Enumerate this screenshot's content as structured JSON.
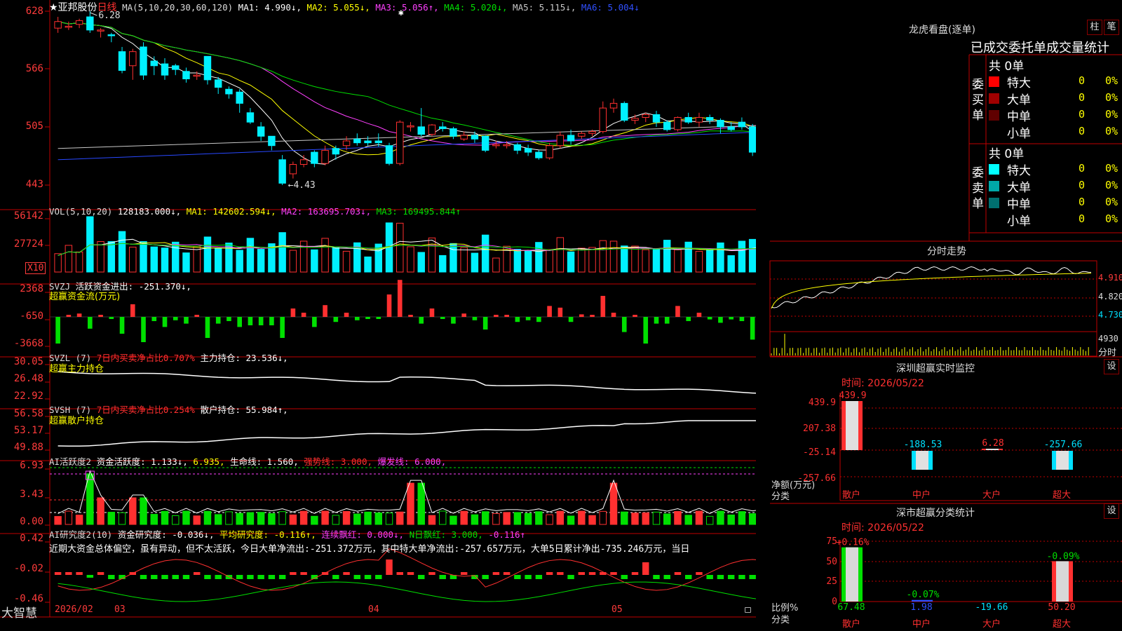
{
  "colors": {
    "up": "#ff3030",
    "down": "#00f0ff",
    "grid": "#c00000",
    "axis": "#ff3b3b",
    "white": "#ffffff",
    "yellow": "#ffff00",
    "magenta": "#ff40ff",
    "green": "#00e000",
    "blue": "#2848ff",
    "gray": "#a0a0a0"
  },
  "main": {
    "title_stock": "★亚邦股份",
    "title_period": "日线",
    "ma_header": [
      {
        "t": "MA(5,10,20,30,60,120)",
        "c": "#dddddd"
      },
      {
        "t": "MA1: 4.990↓,",
        "c": "#ffffff"
      },
      {
        "t": "MA2: 5.055↓,",
        "c": "#ffff00"
      },
      {
        "t": "MA3: 5.056↑,",
        "c": "#ff40ff"
      },
      {
        "t": "MA4: 5.020↓,",
        "c": "#00e000"
      },
      {
        "t": "MA5: 5.115↓,",
        "c": "#c8c8c8"
      },
      {
        "t": "MA6: 5.004↓",
        "c": "#3050ff"
      }
    ],
    "y_ticks": [
      "628",
      "566",
      "505",
      "443"
    ],
    "y_values": [
      6.28,
      5.66,
      5.05,
      4.43
    ],
    "high_label": "6.28",
    "low_label": "←4.43"
  },
  "vol": {
    "header": [
      {
        "t": "VOL(5,10,20)",
        "c": "#dddddd"
      },
      {
        "t": "128183.000↓,",
        "c": "#ffffff"
      },
      {
        "t": "MA1: 142602.594↓,",
        "c": "#ffff00"
      },
      {
        "t": "MA2: 163695.703↓,",
        "c": "#ff40ff"
      },
      {
        "t": "MA3: 169495.844↑",
        "c": "#00e000"
      }
    ],
    "y_ticks": [
      "56142",
      "27724"
    ],
    "unit": "X10"
  },
  "svzj": {
    "header": [
      {
        "t": "SVZJ",
        "c": "#dddddd"
      },
      {
        "t": "活跃资金进出: -251.370↓,",
        "c": "#ffffff"
      }
    ],
    "subtitle": "超赢资金流(万元)",
    "y_ticks": [
      "2368",
      "-650",
      "-3668"
    ]
  },
  "svzl": {
    "header": [
      {
        "t": "SVZL (7)",
        "c": "#dddddd"
      },
      {
        "t": "7日内买卖净占比0.707%",
        "c": "#ff3030"
      },
      {
        "t": "主力持仓: 23.536↓,",
        "c": "#ffffff"
      }
    ],
    "subtitle": "超赢主力持仓",
    "y_ticks": [
      "30.05",
      "26.48",
      "22.92"
    ]
  },
  "svsh": {
    "header": [
      {
        "t": "SVSH (7)",
        "c": "#dddddd"
      },
      {
        "t": "7日内买卖净占比0.254%",
        "c": "#ff3030"
      },
      {
        "t": "散户持仓: 55.984↑,",
        "c": "#ffffff"
      }
    ],
    "subtitle": "超赢散户持仓",
    "y_ticks": [
      "56.58",
      "53.17",
      "49.88"
    ]
  },
  "ai1": {
    "header": [
      {
        "t": "AI活跃度2",
        "c": "#dddddd"
      },
      {
        "t": "资金活跃度: 1.133↓,",
        "c": "#ffffff"
      },
      {
        "t": "6.935,",
        "c": "#ffff00"
      },
      {
        "t": "生命线: 1.560,",
        "c": "#ffffff"
      },
      {
        "t": "强势线: 3.000,",
        "c": "#ff3030"
      },
      {
        "t": "爆发线: 6.000,",
        "c": "#ff40ff"
      }
    ],
    "y_ticks": [
      "6.93",
      "3.43",
      "0.00"
    ]
  },
  "ai2": {
    "header": [
      {
        "t": "AI研究度2(10)",
        "c": "#dddddd"
      },
      {
        "t": "资金研究度: -0.036↓,",
        "c": "#ffffff"
      },
      {
        "t": "平均研究度: -0.116↑,",
        "c": "#ffff00"
      },
      {
        "t": "连续飘红: 0.000↓,",
        "c": "#ff40ff"
      },
      {
        "t": "N日飘红: 3.000,",
        "c": "#00e000"
      },
      {
        "t": "-0.116↑",
        "c": "#ff40ff"
      }
    ],
    "commentary": "近期大资金总体偏空，虽有异动，但不太活跃，今日大单净流出:-251.372万元，其中特大单净流出:-257.657万元，大单5日累计净出-735.246万元，当日",
    "y_ticks": [
      "0.42",
      "-0.02",
      "-0.46"
    ]
  },
  "xaxis": {
    "labels": [
      "2026/02",
      "03",
      "04",
      "05"
    ]
  },
  "brand": "大智慧",
  "right": {
    "lhb_title": "龙虎看盘(逐单)",
    "btn_bar": "柱",
    "btn_bi": "笔",
    "stats_title": "已成交委托单成交量统计",
    "buy_label": "委买单",
    "sell_label": "委卖单",
    "buy_total": "共 0单",
    "sell_total": "共 0单",
    "buy_rows": [
      {
        "name": "特大",
        "count": "0",
        "pct": "0%",
        "color": "#ff0000"
      },
      {
        "name": "大单",
        "count": "0",
        "pct": "0%",
        "color": "#a00000"
      },
      {
        "name": "中单",
        "count": "0",
        "pct": "0%",
        "color": "#600000"
      },
      {
        "name": "小单",
        "count": "0",
        "pct": "0%",
        "color": ""
      }
    ],
    "sell_rows": [
      {
        "name": "特大",
        "count": "0",
        "pct": "0%",
        "color": "#00ffff"
      },
      {
        "name": "大单",
        "count": "0",
        "pct": "0%",
        "color": "#00a8a8"
      },
      {
        "name": "中单",
        "count": "0",
        "pct": "0%",
        "color": "#007070"
      },
      {
        "name": "小单",
        "count": "0",
        "pct": "0%",
        "color": ""
      }
    ],
    "intraday_title": "分时走势",
    "intraday_ticks": [
      "4.910",
      "4.820",
      "4.730"
    ],
    "intraday_vol_tick": "4930",
    "intraday_vol_label": "分时",
    "monitor_title": "深圳超赢实时监控",
    "set_label": "设",
    "monitor_time": "时间: 2026/05/22",
    "monitor_y": [
      "439.9",
      "207.38",
      "-25.14",
      "-257.66"
    ],
    "monitor_bars": [
      {
        "cat": "散户",
        "value": 439.9,
        "label": "439.9",
        "dir": "up"
      },
      {
        "cat": "中户",
        "value": -188.53,
        "label": "-188.53",
        "dir": "down"
      },
      {
        "cat": "大户",
        "value": 6.28,
        "label": "6.28",
        "dir": "up"
      },
      {
        "cat": "超大",
        "value": -257.66,
        "label": "-257.66",
        "dir": "down"
      }
    ],
    "monitor_ylabel": "净额(万元)",
    "monitor_xlabel": "分类",
    "class_title": "深市超赢分类统计",
    "class_time": "时间: 2026/05/22",
    "class_y": [
      "75",
      "50",
      "25",
      "0"
    ],
    "class_bars": [
      {
        "cat": "散户",
        "value": 67.48,
        "bottom": "67.48",
        "top": "+0.16%",
        "bottom_color": "#00e000",
        "top_color": "#ff3030"
      },
      {
        "cat": "中户",
        "value": 1.98,
        "bottom": "1.98",
        "top": "-0.07%",
        "bottom_color": "#3050ff",
        "top_color": "#00e000"
      },
      {
        "cat": "大户",
        "value": -19.66,
        "bottom": "-19.66",
        "top": "",
        "bottom_color": "#00e0ff",
        "top_color": ""
      },
      {
        "cat": "超大",
        "value": 50.2,
        "bottom": "50.20",
        "top": "-0.09%",
        "bottom_color": "#ff3030",
        "top_color": "#00e000"
      }
    ],
    "class_ylabel": "比例%",
    "class_xlabel": "分类"
  },
  "chart_data": {
    "type": "candlestick",
    "series_ohlc": [
      [
        6.1,
        6.17,
        6.22,
        6.05
      ],
      [
        6.12,
        6.12,
        6.17,
        6.08
      ],
      [
        6.14,
        6.18,
        6.2,
        6.1
      ],
      [
        6.22,
        6.08,
        6.28,
        6.05
      ],
      [
        6.08,
        6.08,
        6.1,
        6.0
      ],
      [
        6.03,
        6.02,
        6.05,
        5.95
      ],
      [
        5.85,
        5.65,
        5.9,
        5.62
      ],
      [
        5.7,
        5.85,
        5.88,
        5.55
      ],
      [
        5.9,
        5.6,
        5.95,
        5.55
      ],
      [
        5.75,
        5.7,
        5.8,
        5.6
      ],
      [
        5.72,
        5.6,
        5.78,
        5.55
      ],
      [
        5.7,
        5.66,
        5.72,
        5.6
      ],
      [
        5.64,
        5.56,
        5.68,
        5.52
      ],
      [
        5.6,
        5.6,
        5.64,
        5.55
      ],
      [
        5.8,
        5.55,
        5.8,
        5.5
      ],
      [
        5.55,
        5.47,
        5.58,
        5.4
      ],
      [
        5.45,
        5.4,
        5.48,
        5.35
      ],
      [
        5.42,
        5.3,
        5.45,
        5.2
      ],
      [
        5.2,
        5.1,
        5.25,
        5.08
      ],
      [
        5.05,
        4.95,
        5.1,
        4.9
      ],
      [
        4.95,
        4.85,
        4.95,
        4.8
      ],
      [
        4.7,
        4.45,
        4.75,
        4.43
      ],
      [
        4.55,
        4.65,
        4.68,
        4.5
      ],
      [
        4.65,
        4.7,
        4.75,
        4.62
      ],
      [
        4.78,
        4.66,
        4.8,
        4.62
      ],
      [
        4.66,
        4.8,
        4.85,
        4.64
      ],
      [
        4.82,
        4.76,
        4.85,
        4.7
      ],
      [
        4.85,
        4.9,
        4.95,
        4.8
      ],
      [
        4.92,
        4.88,
        4.98,
        4.85
      ],
      [
        4.9,
        4.88,
        4.95,
        4.85
      ],
      [
        4.9,
        4.88,
        4.98,
        4.84
      ],
      [
        4.85,
        4.66,
        4.88,
        4.64
      ],
      [
        4.66,
        5.1,
        5.12,
        4.64
      ],
      [
        5.05,
        5.06,
        5.1,
        5.0
      ],
      [
        5.05,
        4.97,
        5.25,
        4.95
      ],
      [
        4.97,
        5.07,
        5.08,
        4.95
      ],
      [
        5.05,
        5.03,
        5.1,
        5.0
      ],
      [
        5.03,
        4.95,
        5.05,
        4.92
      ],
      [
        4.92,
        4.96,
        5.0,
        4.9
      ],
      [
        4.96,
        4.92,
        5.0,
        4.88
      ],
      [
        4.95,
        4.8,
        4.96,
        4.78
      ],
      [
        4.86,
        4.86,
        4.9,
        4.82
      ],
      [
        4.86,
        4.86,
        4.9,
        4.82
      ],
      [
        4.86,
        4.8,
        4.88,
        4.76
      ],
      [
        4.82,
        4.78,
        4.86,
        4.74
      ],
      [
        4.78,
        4.72,
        4.8,
        4.7
      ],
      [
        4.72,
        4.85,
        4.88,
        4.7
      ],
      [
        4.85,
        4.96,
        5.0,
        4.82
      ],
      [
        4.96,
        4.9,
        5.02,
        4.86
      ],
      [
        4.95,
        4.98,
        5.0,
        4.92
      ],
      [
        4.98,
        5.0,
        5.02,
        4.95
      ],
      [
        5.0,
        5.25,
        5.32,
        4.98
      ],
      [
        5.25,
        5.3,
        5.35,
        5.2
      ],
      [
        5.3,
        5.12,
        5.32,
        5.1
      ],
      [
        5.12,
        5.14,
        5.18,
        5.08
      ],
      [
        5.15,
        5.18,
        5.2,
        5.1
      ],
      [
        5.18,
        5.1,
        5.22,
        5.05
      ],
      [
        5.1,
        5.02,
        5.12,
        5.0
      ],
      [
        5.02,
        5.15,
        5.16,
        5.0
      ],
      [
        5.15,
        5.1,
        5.2,
        5.08
      ],
      [
        5.1,
        5.15,
        5.2,
        5.05
      ],
      [
        5.15,
        5.12,
        5.18,
        5.08
      ],
      [
        5.12,
        5.05,
        5.14,
        4.98
      ],
      [
        5.05,
        5.02,
        5.1,
        5.0
      ],
      [
        5.1,
        5.05,
        5.15,
        5.02
      ],
      [
        5.05,
        4.78,
        5.08,
        4.74
      ],
      [
        4.82,
        4.95,
        4.98,
        4.75
      ]
    ],
    "up_color": "#ff3030",
    "down_color": "#00f0ff",
    "ylim": [
      4.43,
      6.28
    ]
  }
}
